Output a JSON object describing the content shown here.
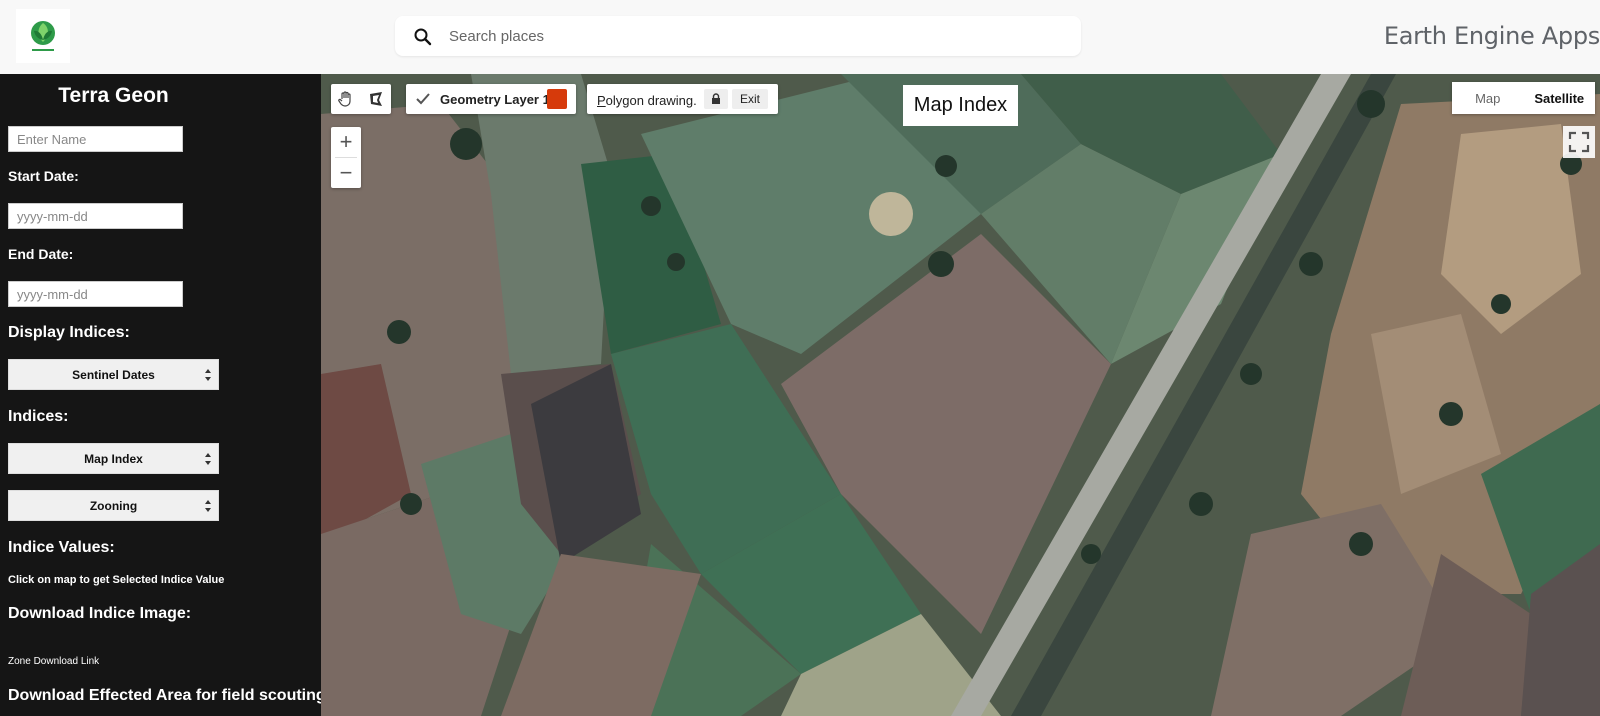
{
  "header": {
    "search_placeholder": "Search places",
    "app_title": "Earth Engine Apps",
    "icons": {
      "logo": "leaf-logo-icon",
      "search": "search-icon"
    }
  },
  "panel": {
    "title": "Terra Geon",
    "name_placeholder": "Enter Name",
    "start_date_label": "Start Date:",
    "start_date_placeholder": "yyyy-mm-dd",
    "end_date_label": "End Date:",
    "end_date_placeholder": "yyyy-mm-dd",
    "display_indices_label": "Display Indices:",
    "display_select_value": "Sentinel Dates",
    "indices_label": "Indices:",
    "indices_select_value": "Map Index",
    "zoning_select_value": "Zooning",
    "indice_values_label": "Indice Values:",
    "click_hint": "Click on map to get Selected Indice Value",
    "download_image_label": "Download Indice Image:",
    "zone_download_link": "Zone Download Link",
    "download_effected_label": "Download Effected Area for field scouting"
  },
  "map": {
    "drawing_tools": {
      "pan_icon": "hand-icon",
      "polygon_icon": "polygon-icon"
    },
    "geometry_layer": {
      "label": "Geometry Layer 1",
      "checked": true,
      "color": "#d63a0b"
    },
    "polygon_drawing": {
      "label_first": "P",
      "label_rest": "olygon drawing.",
      "exit_label": "Exit",
      "lock_icon": "lock-icon"
    },
    "zoom_in": "+",
    "zoom_out": "−",
    "index_label": "Map Index",
    "map_type": {
      "map": "Map",
      "satellite": "Satellite",
      "selected": "Satellite"
    },
    "fullscreen_icon": "fullscreen-icon"
  }
}
